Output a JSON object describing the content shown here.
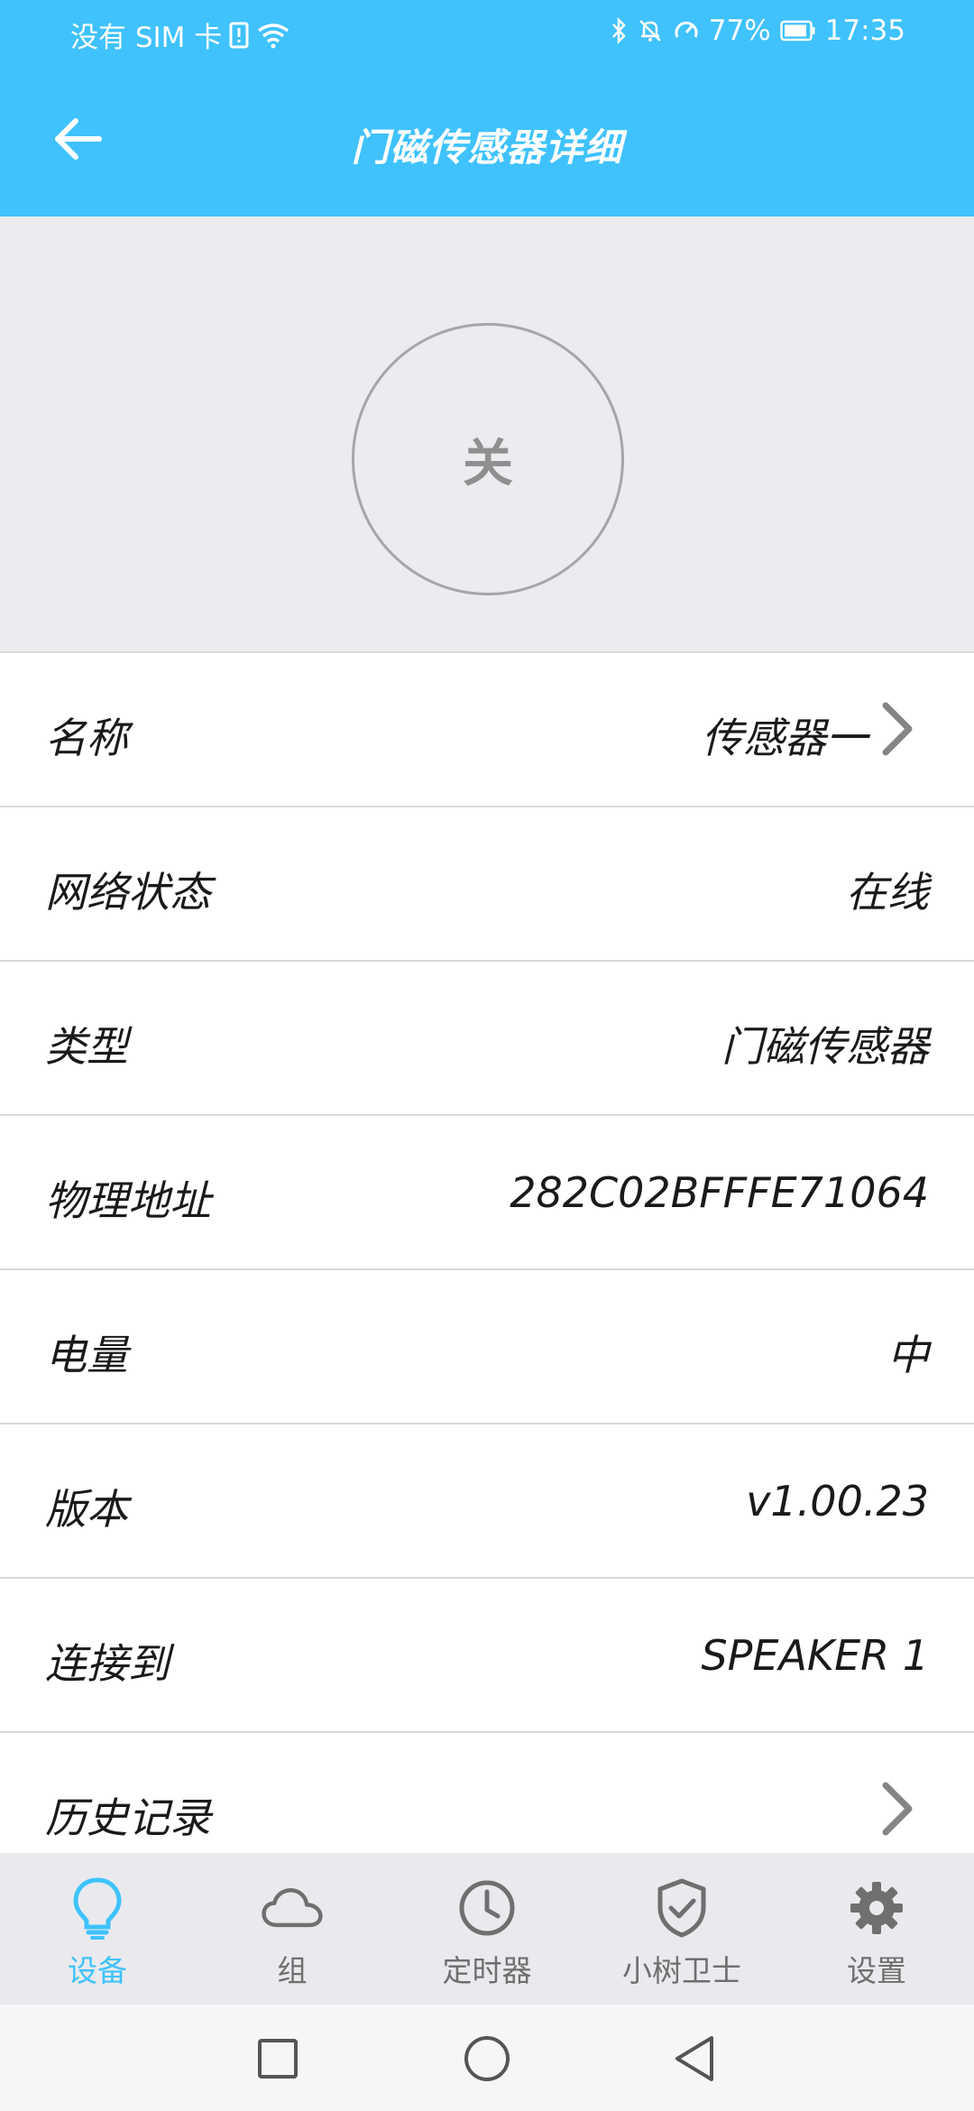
{
  "status_bar": {
    "carrier": "没有 SIM 卡",
    "battery_percent": "77%",
    "time": "17:35"
  },
  "header": {
    "title": "门磁传感器详细"
  },
  "sensor_state": {
    "label": "关"
  },
  "details": [
    {
      "label": "名称",
      "value": "传感器一",
      "has_arrow": true
    },
    {
      "label": "网络状态",
      "value": "在线",
      "has_arrow": false
    },
    {
      "label": "类型",
      "value": "门磁传感器",
      "has_arrow": false
    },
    {
      "label": "物理地址",
      "value": "282C02BFFFE71064",
      "has_arrow": false
    },
    {
      "label": "电量",
      "value": "中",
      "has_arrow": false
    },
    {
      "label": "版本",
      "value": "v1.00.23",
      "has_arrow": false
    },
    {
      "label": "连接到",
      "value": "SPEAKER 1",
      "has_arrow": false
    },
    {
      "label": "历史记录",
      "value": "",
      "has_arrow": true
    }
  ],
  "bottom_nav": [
    {
      "label": "设备",
      "icon": "bulb-icon",
      "active": true
    },
    {
      "label": "组",
      "icon": "cloud-icon",
      "active": false
    },
    {
      "label": "定时器",
      "icon": "clock-icon",
      "active": false
    },
    {
      "label": "小树卫士",
      "icon": "shield-check-icon",
      "active": false
    },
    {
      "label": "设置",
      "icon": "gear-icon",
      "active": false
    }
  ],
  "colors": {
    "primary": "#3fc2fd",
    "panel_bg": "#ebebf0",
    "nav_bg": "#eaeaee"
  }
}
